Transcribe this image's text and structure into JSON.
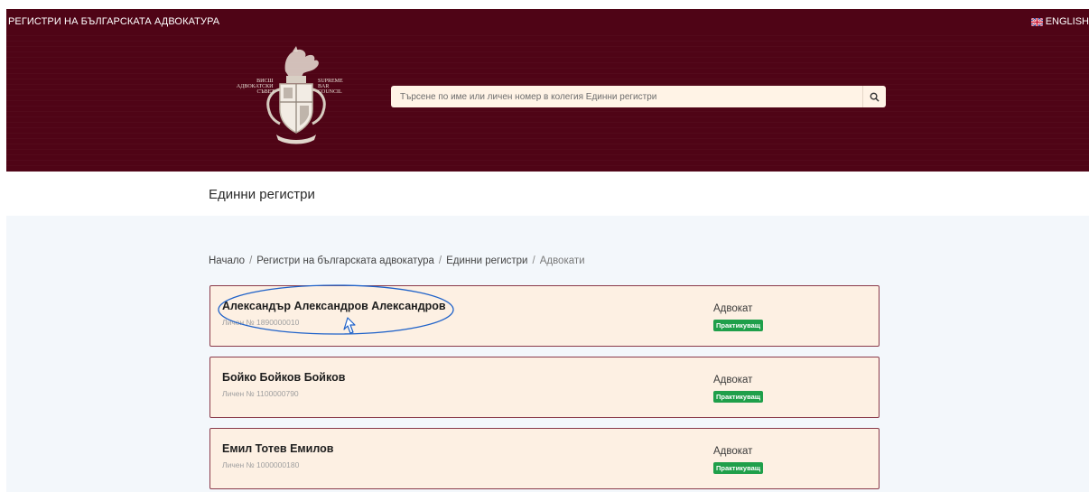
{
  "header": {
    "site_title": "РЕГИСТРИ НА БЪЛГАРСКАТА АДВОКАТУРА",
    "language": "ENGLISH"
  },
  "logo": {
    "left_text": "ВИСШ АДВОКАТСКИ СЪВЕТ",
    "right_text": "SUPREME BAR COUNCIL"
  },
  "search": {
    "placeholder": "Търсене по име или личен номер в колегия Единни регистри"
  },
  "page_title": "Единни регистри",
  "breadcrumb": [
    "Начало",
    "Регистри на българската адвокатура",
    "Единни регистри",
    "Адвокати"
  ],
  "lawyers": [
    {
      "name": "Александър Александров Александров",
      "reg": "Личен № 1890000010",
      "role": "Адвокат",
      "status": "Практикуващ"
    },
    {
      "name": "Бойко Бойков Бойков",
      "reg": "Личен № 1100000790",
      "role": "Адвокат",
      "status": "Практикуващ"
    },
    {
      "name": "Емил Тотев Емилов",
      "reg": "Личен № 1000000180",
      "role": "Адвокат",
      "status": "Практикуващ"
    }
  ],
  "colors": {
    "brand": "#4f0416",
    "card_bg": "#fdf0e3",
    "status_green": "#1f9f4a",
    "annotation_blue": "#1f62c9"
  },
  "icons": [
    "uk-flag-icon",
    "coat-of-arms-logo",
    "search-icon",
    "cursor-icon"
  ]
}
